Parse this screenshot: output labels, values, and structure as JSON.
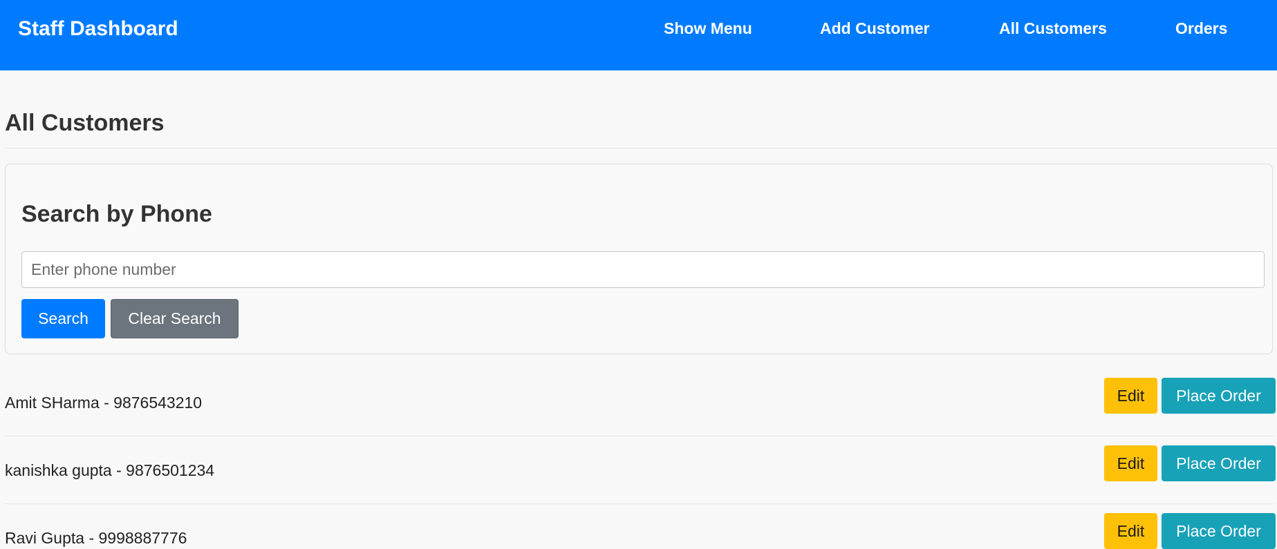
{
  "navbar": {
    "brand": "Staff Dashboard",
    "links": [
      {
        "label": "Show Menu"
      },
      {
        "label": "Add Customer"
      },
      {
        "label": "All Customers"
      },
      {
        "label": "Orders"
      }
    ]
  },
  "page": {
    "title": "All Customers"
  },
  "search": {
    "heading": "Search by Phone",
    "input_value": "",
    "input_placeholder": "Enter phone number",
    "search_label": "Search",
    "clear_label": "Clear Search"
  },
  "customers": [
    {
      "display": "Amit SHarma - 9876543210",
      "edit_label": "Edit",
      "order_label": "Place Order"
    },
    {
      "display": "kanishka gupta - 9876501234",
      "edit_label": "Edit",
      "order_label": "Place Order"
    },
    {
      "display": "Ravi Gupta - 9998887776",
      "edit_label": "Edit",
      "order_label": "Place Order"
    }
  ],
  "colors": {
    "navbar_bg": "#007bff",
    "primary": "#007bff",
    "secondary": "#6c757d",
    "warning": "#ffc107",
    "info": "#17a2b8",
    "page_bg": "#f8f8f8"
  }
}
